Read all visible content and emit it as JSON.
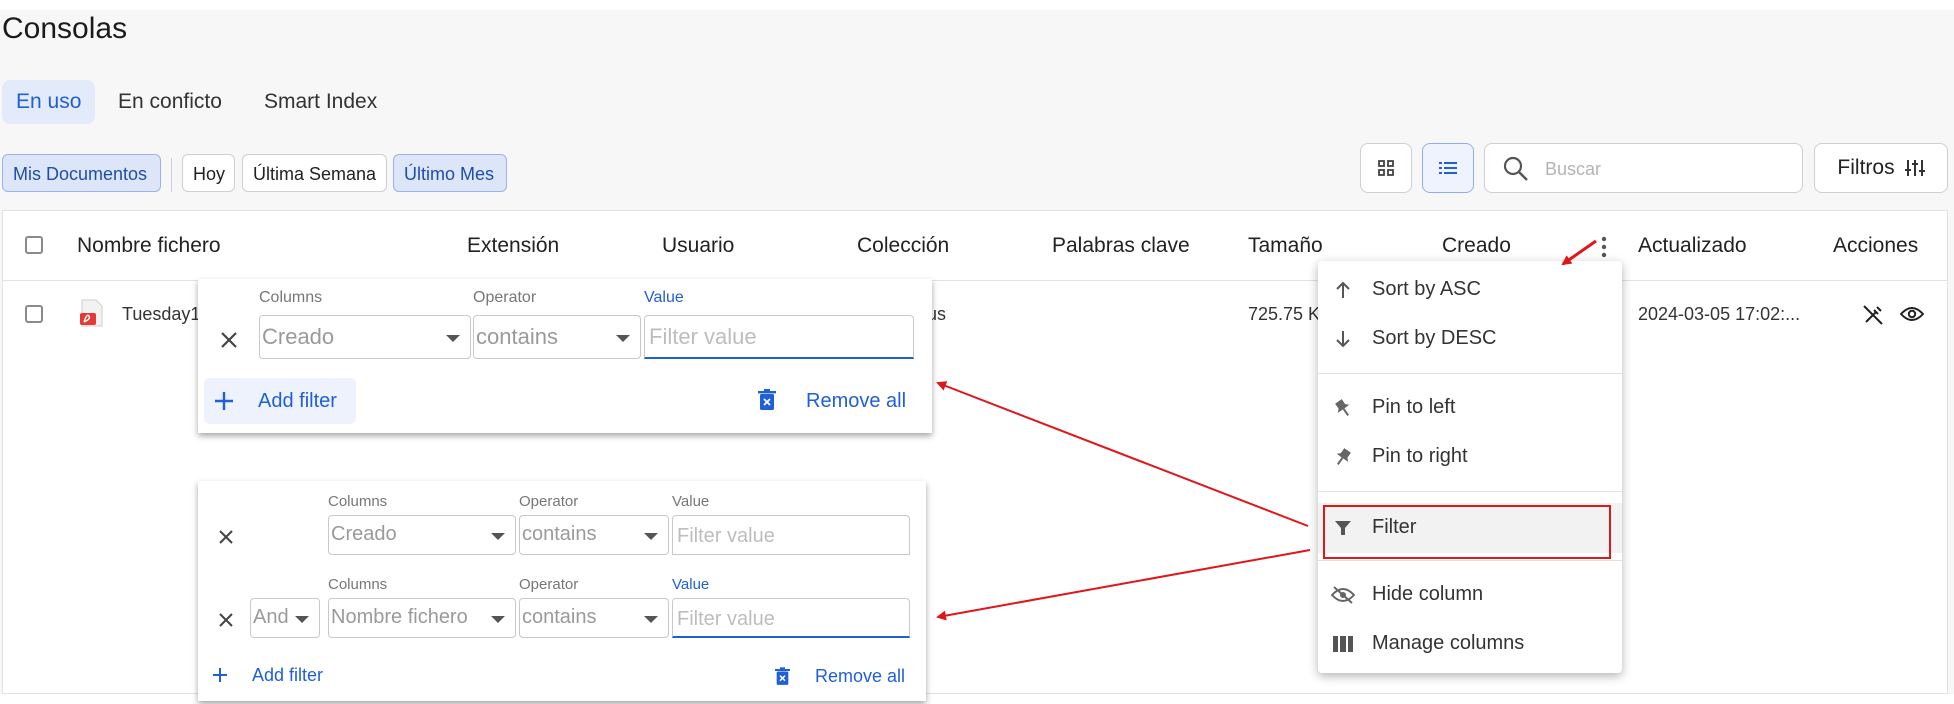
{
  "page": {
    "title": "Consolas"
  },
  "tabs": [
    {
      "label": "En uso",
      "active": true
    },
    {
      "label": "En conficto",
      "active": false
    },
    {
      "label": "Smart Index",
      "active": false
    }
  ],
  "chips": [
    {
      "label": "Mis Documentos",
      "selected": true
    },
    {
      "label": "Hoy",
      "selected": false
    },
    {
      "label": "Última Semana",
      "selected": false
    },
    {
      "label": "Último Mes",
      "selected": true
    }
  ],
  "toolbar": {
    "grid_view_icon": "grid-icon",
    "list_view_icon": "list-icon",
    "search_placeholder": "Buscar",
    "filters_label": "Filtros"
  },
  "table": {
    "headers": [
      "Nombre fichero",
      "Extensión",
      "Usuario",
      "Colección",
      "Palabras clave",
      "Tamaño",
      "Creado",
      "Actualizado",
      "Acciones"
    ],
    "row": {
      "name": "Tuesday1",
      "collection_tail": "us",
      "size": "725.75 K",
      "updated": "2024-03-05 17:02:..."
    }
  },
  "filter_panel_1": {
    "columns_label": "Columns",
    "operator_label": "Operator",
    "value_label": "Value",
    "column_value": "Creado",
    "operator_value": "contains",
    "value_placeholder": "Filter value",
    "add_filter": "Add filter",
    "remove_all": "Remove all"
  },
  "filter_panel_2": {
    "rows": [
      {
        "columns_label": "Columns",
        "operator_label": "Operator",
        "value_label": "Value",
        "column_value": "Creado",
        "operator_value": "contains",
        "value_placeholder": "Filter value"
      },
      {
        "logic": "And",
        "columns_label": "Columns",
        "operator_label": "Operator",
        "value_label": "Value",
        "column_value": "Nombre fichero",
        "operator_value": "contains",
        "value_placeholder": "Filter value"
      }
    ],
    "add_filter": "Add filter",
    "remove_all": "Remove all"
  },
  "column_menu": {
    "items": [
      {
        "label": "Sort by ASC",
        "icon": "arrow-up-icon"
      },
      {
        "label": "Sort by DESC",
        "icon": "arrow-down-icon"
      },
      {
        "label": "Pin to left",
        "icon": "pin-left-icon"
      },
      {
        "label": "Pin to right",
        "icon": "pin-right-icon"
      },
      {
        "label": "Filter",
        "icon": "filter-icon",
        "highlighted": true
      },
      {
        "label": "Hide column",
        "icon": "eye-off-icon"
      },
      {
        "label": "Manage columns",
        "icon": "columns-icon"
      }
    ]
  },
  "colors": {
    "accent": "#1f5fd8",
    "annotation": "#e0161b",
    "pdf": "#e53935"
  }
}
